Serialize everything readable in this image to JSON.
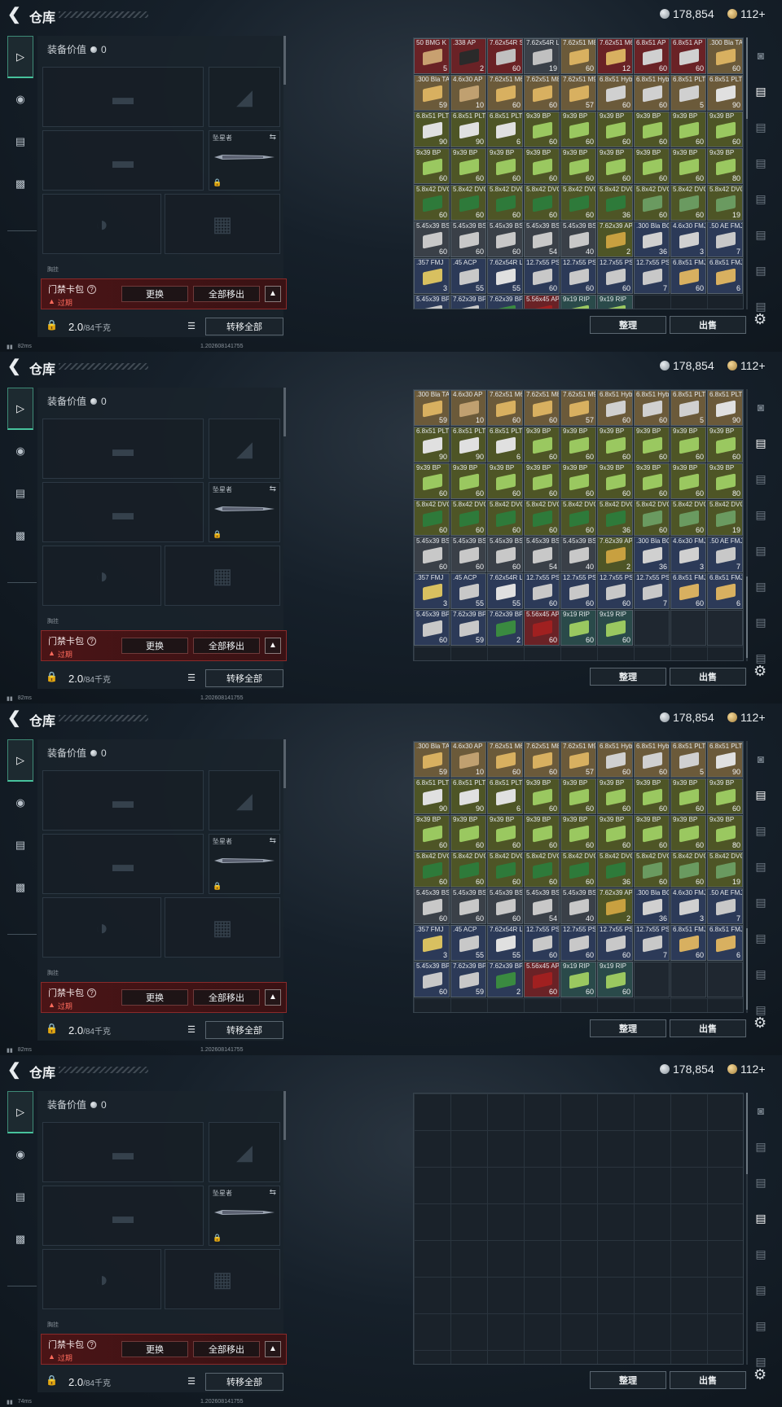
{
  "header": {
    "title": "仓库",
    "silver": "178,854",
    "gold": "112+"
  },
  "rail": [
    "pistol-icon",
    "helmet-icon",
    "clipboard-icon",
    "briefcase-icon"
  ],
  "equip": {
    "value_label": "装备价值",
    "value": "0",
    "melee_name": "坠星者",
    "section_label": "胸挂",
    "card_name": "门禁卡包",
    "card_status": "过期",
    "replace_button": "更换",
    "move_all_out_button": "全部移出",
    "weight_value": "2.0",
    "weight_capacity": "/84千克",
    "transfer_all_button": "转移全部"
  },
  "actions": {
    "sort_button": "整理",
    "sell_button": "出售"
  },
  "item_colors": {
    "red": "#6a2226",
    "tan": "#6b5a3a",
    "green": "#3f5a2a",
    "olive": "#4e5526",
    "blue": "#2c3a58",
    "grey": "#3a4048",
    "teal": "#2a4a4a"
  },
  "items": [
    {
      "name": "50 BMG K",
      "qty": "5",
      "color": "red",
      "box": "#c8a070"
    },
    {
      "name": ".338 AP",
      "qty": "2",
      "color": "red",
      "box": "#2a2a2a"
    },
    {
      "name": "7.62x54R SNB",
      "qty": "60",
      "color": "red",
      "box": "#c0c0c0"
    },
    {
      "name": "7.62x54R LPS",
      "qty": "19",
      "color": "grey",
      "box": "#c0c0c0"
    },
    {
      "name": "7.62x51 M80",
      "qty": "60",
      "color": "tan",
      "box": "#d8b060"
    },
    {
      "name": "7.62x51 M61",
      "qty": "12",
      "color": "red",
      "box": "#d8b060"
    },
    {
      "name": "6.8x51 AP",
      "qty": "60",
      "color": "red",
      "box": "#d0d0d0"
    },
    {
      "name": "6.8x51 AP",
      "qty": "60",
      "color": "red",
      "box": "#d0d0d0"
    },
    {
      "name": ".300 Bla TAC-TX",
      "qty": "60",
      "color": "tan",
      "box": "#d8b060"
    },
    {
      "name": ".300 Bla TAC-TX",
      "qty": "59",
      "color": "tan",
      "box": "#d8b060"
    },
    {
      "name": "4.6x30 AP",
      "qty": "10",
      "color": "tan",
      "box": "#c0a070"
    },
    {
      "name": "7.62x51 M62",
      "qty": "60",
      "color": "tan",
      "box": "#d8b060"
    },
    {
      "name": "7.62x51 M80",
      "qty": "60",
      "color": "tan",
      "box": "#d8b060"
    },
    {
      "name": "7.62x51 M993",
      "qty": "57",
      "color": "tan",
      "box": "#d8b060"
    },
    {
      "name": "6.8x51 Hybrid",
      "qty": "60",
      "color": "tan",
      "box": "#d0d0d0"
    },
    {
      "name": "6.8x51 Hybrid",
      "qty": "60",
      "color": "tan",
      "box": "#d0d0d0"
    },
    {
      "name": "6.8x51 PLT",
      "qty": "5",
      "color": "tan",
      "box": "#d0d0d0"
    },
    {
      "name": "6.8x51 PLT",
      "qty": "90",
      "color": "tan",
      "box": "#e0e0e0"
    },
    {
      "name": "6.8x51 PLT",
      "qty": "90",
      "color": "olive",
      "box": "#e0e0e0"
    },
    {
      "name": "6.8x51 PLT",
      "qty": "90",
      "color": "olive",
      "box": "#e0e0e0"
    },
    {
      "name": "6.8x51 PLT",
      "qty": "6",
      "color": "olive",
      "box": "#e0e0e0"
    },
    {
      "name": "9x39 BP",
      "qty": "60",
      "color": "olive",
      "box": "#9ac860"
    },
    {
      "name": "9x39 BP",
      "qty": "60",
      "color": "olive",
      "box": "#9ac860"
    },
    {
      "name": "9x39 BP",
      "qty": "60",
      "color": "olive",
      "box": "#9ac860"
    },
    {
      "name": "9x39 BP",
      "qty": "60",
      "color": "olive",
      "box": "#9ac860"
    },
    {
      "name": "9x39 BP",
      "qty": "60",
      "color": "olive",
      "box": "#9ac860"
    },
    {
      "name": "9x39 BP",
      "qty": "60",
      "color": "olive",
      "box": "#9ac860"
    },
    {
      "name": "9x39 BP",
      "qty": "60",
      "color": "olive",
      "box": "#9ac860"
    },
    {
      "name": "9x39 BP",
      "qty": "60",
      "color": "olive",
      "box": "#9ac860"
    },
    {
      "name": "9x39 BP",
      "qty": "60",
      "color": "olive",
      "box": "#9ac860"
    },
    {
      "name": "9x39 BP",
      "qty": "60",
      "color": "olive",
      "box": "#9ac860"
    },
    {
      "name": "9x39 BP",
      "qty": "60",
      "color": "olive",
      "box": "#9ac860"
    },
    {
      "name": "9x39 BP",
      "qty": "60",
      "color": "olive",
      "box": "#9ac860"
    },
    {
      "name": "9x39 BP",
      "qty": "60",
      "color": "olive",
      "box": "#9ac860"
    },
    {
      "name": "9x39 BP",
      "qty": "60",
      "color": "olive",
      "box": "#9ac860"
    },
    {
      "name": "9x39 BP",
      "qty": "80",
      "color": "olive",
      "box": "#9ac860"
    },
    {
      "name": "5.8x42 DVC12+P",
      "qty": "60",
      "color": "olive",
      "box": "#2e7a3a"
    },
    {
      "name": "5.8x42 DVC12+P",
      "qty": "60",
      "color": "olive",
      "box": "#2e7a3a"
    },
    {
      "name": "5.8x42 DVC12+P",
      "qty": "60",
      "color": "olive",
      "box": "#2e7a3a"
    },
    {
      "name": "5.8x42 DVC12+P",
      "qty": "60",
      "color": "olive",
      "box": "#2e7a3a"
    },
    {
      "name": "5.8x42 DVC12+P",
      "qty": "60",
      "color": "olive",
      "box": "#2e7a3a"
    },
    {
      "name": "5.8x42 DVC12+P",
      "qty": "36",
      "color": "olive",
      "box": "#2e7a3a"
    },
    {
      "name": "5.8x42 DVC12",
      "qty": "60",
      "color": "olive",
      "box": "#6a9a60"
    },
    {
      "name": "5.8x42 DVC12",
      "qty": "60",
      "color": "olive",
      "box": "#6a9a60"
    },
    {
      "name": "5.8x42 DVC12",
      "qty": "19",
      "color": "olive",
      "box": "#6a9a60"
    },
    {
      "name": "5.45x39 BS",
      "qty": "60",
      "color": "grey",
      "box": "#c8c8c8"
    },
    {
      "name": "5.45x39 BS",
      "qty": "60",
      "color": "grey",
      "box": "#c8c8c8"
    },
    {
      "name": "5.45x39 BS",
      "qty": "60",
      "color": "grey",
      "box": "#c8c8c8"
    },
    {
      "name": "5.45x39 BS",
      "qty": "54",
      "color": "grey",
      "box": "#c8c8c8"
    },
    {
      "name": "5.45x39 BS",
      "qty": "40",
      "color": "grey",
      "box": "#c8c8c8"
    },
    {
      "name": "7.62x39 AP",
      "qty": "2",
      "color": "olive",
      "box": "#c8a040"
    },
    {
      "name": ".300 Bla BCP FMJ",
      "qty": "36",
      "color": "blue",
      "box": "#d0d0d0"
    },
    {
      "name": "4.6x30 FMJ",
      "qty": "3",
      "color": "blue",
      "box": "#d0d0d0"
    },
    {
      "name": ".50 AE FMJ",
      "qty": "7",
      "color": "blue",
      "box": "#c8c8c8"
    },
    {
      "name": ".357 FMJ",
      "qty": "3",
      "color": "blue",
      "box": "#d8c060"
    },
    {
      "name": ".45 ACP",
      "qty": "55",
      "color": "blue",
      "box": "#c8c8c8"
    },
    {
      "name": "7.62x54R LPS",
      "qty": "55",
      "color": "blue",
      "box": "#e0e0e0"
    },
    {
      "name": "12.7x55 PS12A",
      "qty": "60",
      "color": "blue",
      "box": "#c8c8c8"
    },
    {
      "name": "12.7x55 PS12A",
      "qty": "60",
      "color": "blue",
      "box": "#c8c8c8"
    },
    {
      "name": "12.7x55 PS12A",
      "qty": "60",
      "color": "blue",
      "box": "#c8c8c8"
    },
    {
      "name": "12.7x55 PS12A",
      "qty": "7",
      "color": "blue",
      "box": "#c8c8c8"
    },
    {
      "name": "6.8x51 FMJ",
      "qty": "60",
      "color": "blue",
      "box": "#d8b060"
    },
    {
      "name": "6.8x51 FMJ",
      "qty": "6",
      "color": "blue",
      "box": "#d8b060"
    },
    {
      "name": "5.45x39 BP",
      "qty": "60",
      "color": "blue",
      "box": "#c8c8c8"
    },
    {
      "name": "7.62x39 BP",
      "qty": "59",
      "color": "blue",
      "box": "#c8c8c8"
    },
    {
      "name": "7.62x39 BP",
      "qty": "2",
      "color": "blue",
      "box": "#3a8a40"
    },
    {
      "name": "5.56x45 AP",
      "qty": "60",
      "color": "red",
      "box": "#a02020"
    },
    {
      "name": "9x19 RIP",
      "qty": "60",
      "color": "teal",
      "box": "#9ac860"
    },
    {
      "name": "9x19 RIP",
      "qty": "60",
      "color": "teal",
      "box": "#9ac860"
    }
  ],
  "frames": [
    {
      "ping": "82ms",
      "build": "1.202608141755"
    },
    {
      "ping": "82ms",
      "build": "1.202608141755"
    },
    {
      "ping": "82ms",
      "build": "1.202608141755"
    },
    {
      "ping": "74ms",
      "build": "1.202608141755"
    }
  ]
}
